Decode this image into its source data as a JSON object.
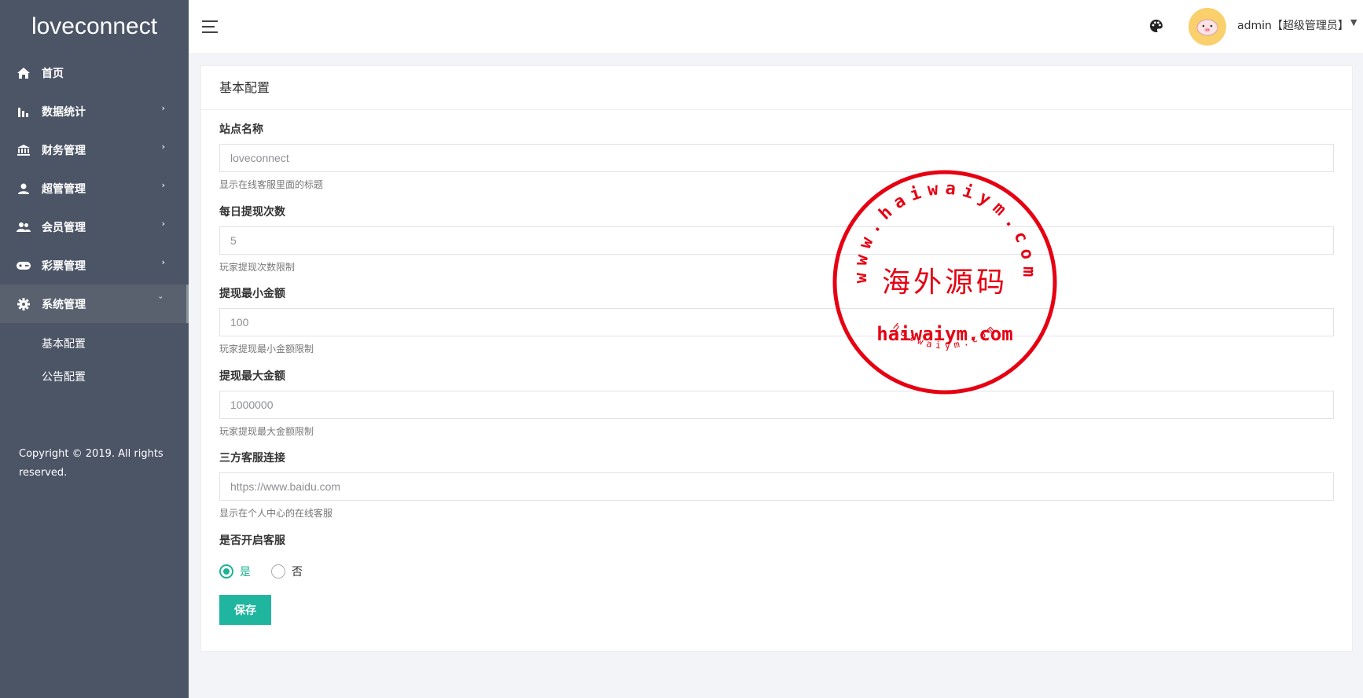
{
  "brand": "loveconnect",
  "sidebar": {
    "items": [
      {
        "label": "首页",
        "icon": "home-icon",
        "arrow": ""
      },
      {
        "label": "数据统计",
        "icon": "bar-chart-icon",
        "arrow": "›"
      },
      {
        "label": "财务管理",
        "icon": "bank-icon",
        "arrow": "›"
      },
      {
        "label": "超管管理",
        "icon": "user-icon",
        "arrow": "›"
      },
      {
        "label": "会员管理",
        "icon": "users-icon",
        "arrow": "›"
      },
      {
        "label": "彩票管理",
        "icon": "gamepad-icon",
        "arrow": "›"
      },
      {
        "label": "系统管理",
        "icon": "gear-icon",
        "arrow": "ˇ"
      }
    ],
    "sub_items": [
      {
        "label": "基本配置"
      },
      {
        "label": "公告配置"
      }
    ],
    "copyright": "Copyright © 2019. All rights reserved."
  },
  "topbar": {
    "user": "admin【超级管理员】"
  },
  "card": {
    "title": "基本配置"
  },
  "form": {
    "fields": [
      {
        "label": "站点名称",
        "value": "loveconnect",
        "hint": "显示在线客服里面的标题"
      },
      {
        "label": "每日提现次数",
        "value": "5",
        "hint": "玩家提现次数限制"
      },
      {
        "label": "提现最小金额",
        "value": "100",
        "hint": "玩家提现最小金额限制"
      },
      {
        "label": "提现最大金额",
        "value": "1000000",
        "hint": "玩家提现最大金额限制"
      },
      {
        "label": "三方客服连接",
        "value": "https://www.baidu.com",
        "hint": "显示在个人中心的在线客服"
      }
    ],
    "service_label": "是否开启客服",
    "radio_yes": "是",
    "radio_no": "否",
    "service_enabled": true,
    "save_label": "保存"
  },
  "stamp": {
    "arc_top": "www.haiwaiym.com",
    "center": "海外源码",
    "domain": "haiwaiym.com",
    "arc_bottom": "haiwaiym.com"
  },
  "colors": {
    "sidebar": "#4c5566",
    "accent": "#1fb59e",
    "stamp": "#e60012"
  }
}
